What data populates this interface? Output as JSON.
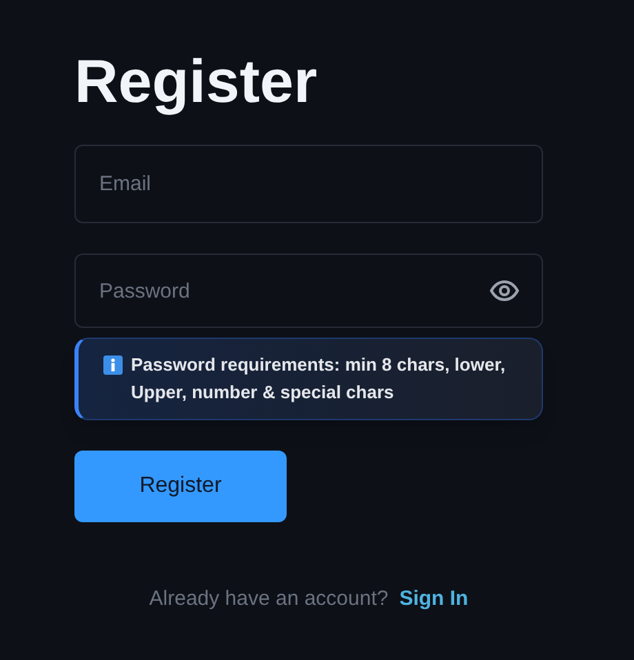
{
  "title": "Register",
  "fields": [
    {
      "kind": "email",
      "placeholder": "Email"
    },
    {
      "kind": "password",
      "placeholder": "Password"
    }
  ],
  "hint": {
    "text": "Password requirements: min 8 chars, lower, Upper, number & special chars"
  },
  "submit": {
    "label": "Register"
  },
  "footer": {
    "text": "Already have an account?",
    "link": "Sign In"
  }
}
